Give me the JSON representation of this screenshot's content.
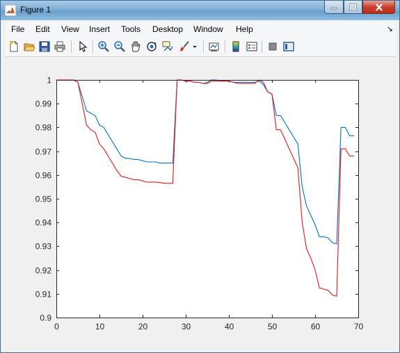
{
  "window": {
    "title": "Figure 1",
    "controls": [
      "minimize",
      "maximize",
      "close"
    ]
  },
  "menu": [
    "File",
    "Edit",
    "View",
    "Insert",
    "Tools",
    "Desktop",
    "Window",
    "Help"
  ],
  "toolbar": {
    "icons": [
      "new-figure-icon",
      "open-file-icon",
      "save-icon",
      "print-icon",
      "edit-plot-icon",
      "zoom-in-icon",
      "zoom-out-icon",
      "pan-icon",
      "rotate-3d-icon",
      "data-cursor-icon",
      "brush-icon",
      "link-plot-icon",
      "colorbar-icon",
      "legend-icon",
      "hide-plot-tools-icon",
      "show-plot-tools-icon"
    ]
  },
  "colors": {
    "series_1": "#0072bd",
    "series_2": "#e8161b"
  },
  "chart_data": {
    "type": "line",
    "title": "",
    "xlabel": "",
    "ylabel": "",
    "xlim": [
      0,
      70
    ],
    "ylim": [
      0.9,
      1.0
    ],
    "xticks": [
      "0",
      "10",
      "20",
      "30",
      "40",
      "50",
      "60",
      "70"
    ],
    "yticks": [
      "0.9",
      "0.91",
      "0.92",
      "0.93",
      "0.94",
      "0.95",
      "0.96",
      "0.97",
      "0.98",
      "0.99",
      "1"
    ],
    "grid": false,
    "series": [
      {
        "color": "#0072bd",
        "x": [
          0,
          4,
          5,
          6,
          7,
          8,
          9,
          10,
          11,
          12,
          13,
          14,
          15,
          16,
          17,
          18,
          19,
          20,
          21,
          22,
          23,
          24,
          25,
          26,
          27,
          28,
          29,
          30,
          31,
          32,
          33,
          34,
          35,
          36,
          37,
          38,
          39,
          40,
          41,
          42,
          43,
          44,
          45,
          46,
          47,
          48,
          49,
          50,
          51,
          52,
          53,
          54,
          55,
          56,
          57,
          58,
          59,
          60,
          61,
          62,
          63,
          64,
          65,
          66,
          67,
          68,
          69
        ],
        "y": [
          1.0,
          1.0,
          0.999,
          0.993,
          0.987,
          0.986,
          0.985,
          0.981,
          0.98,
          0.977,
          0.974,
          0.971,
          0.968,
          0.967,
          0.967,
          0.9665,
          0.9665,
          0.966,
          0.9655,
          0.9655,
          0.9655,
          0.965,
          0.965,
          0.965,
          0.965,
          1.0,
          1.0,
          0.9995,
          0.9995,
          0.999,
          0.999,
          0.9985,
          0.999,
          1.0,
          1.0,
          0.9995,
          0.9995,
          0.9995,
          0.999,
          0.999,
          0.999,
          0.999,
          0.999,
          0.999,
          0.9995,
          0.998,
          0.995,
          0.994,
          0.985,
          0.985,
          0.982,
          0.979,
          0.976,
          0.973,
          0.955,
          0.947,
          0.943,
          0.939,
          0.934,
          0.934,
          0.9335,
          0.9315,
          0.931,
          0.98,
          0.98,
          0.9765,
          0.9765
        ]
      },
      {
        "color": "#e8161b",
        "x": [
          0,
          4,
          5,
          6,
          7,
          8,
          9,
          10,
          11,
          12,
          13,
          14,
          15,
          16,
          17,
          18,
          19,
          20,
          21,
          22,
          23,
          24,
          25,
          26,
          27,
          28,
          29,
          30,
          31,
          32,
          33,
          34,
          35,
          36,
          37,
          38,
          39,
          40,
          41,
          42,
          43,
          44,
          45,
          46,
          47,
          48,
          49,
          50,
          51,
          52,
          53,
          54,
          55,
          56,
          57,
          58,
          59,
          60,
          61,
          62,
          63,
          64,
          65,
          66,
          67,
          68,
          69
        ],
        "y": [
          1.0,
          1.0,
          0.999,
          0.99,
          0.981,
          0.979,
          0.978,
          0.973,
          0.971,
          0.968,
          0.965,
          0.962,
          0.9595,
          0.959,
          0.9585,
          0.958,
          0.958,
          0.9575,
          0.957,
          0.957,
          0.957,
          0.9568,
          0.9565,
          0.9565,
          0.9565,
          1.0,
          1.0,
          0.9995,
          0.9995,
          0.999,
          0.999,
          0.9985,
          0.9985,
          0.9995,
          0.9995,
          0.9995,
          0.9995,
          0.9995,
          0.999,
          0.9985,
          0.9985,
          0.9985,
          0.9985,
          0.9985,
          1.0,
          0.999,
          0.995,
          0.994,
          0.979,
          0.979,
          0.975,
          0.971,
          0.967,
          0.963,
          0.94,
          0.929,
          0.925,
          0.92,
          0.9125,
          0.912,
          0.9115,
          0.9095,
          0.909,
          0.971,
          0.971,
          0.968,
          0.968
        ]
      }
    ]
  }
}
